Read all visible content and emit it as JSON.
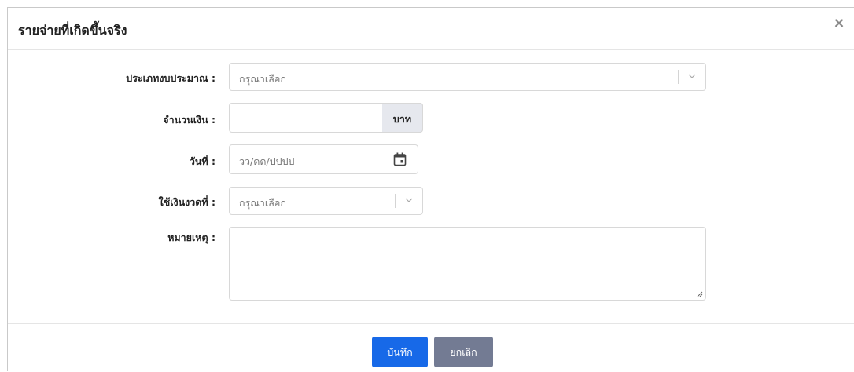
{
  "dialog": {
    "title": "รายจ่ายที่เกิดขึ้นจริง",
    "close_glyph": "×"
  },
  "form": {
    "budget_type": {
      "label": "ประเภทงบประมาณ :",
      "placeholder": "กรุณาเลือก"
    },
    "amount": {
      "label": "จำนวนเงิน :",
      "value": "",
      "unit": "บาท"
    },
    "date": {
      "label": "วันที่ :",
      "placeholder": "วว/ดด/ปปปป"
    },
    "installment": {
      "label": "ใช้เงินงวดที่ :",
      "placeholder": "กรุณาเลือก"
    },
    "note": {
      "label": "หมายเหตุ :",
      "value": ""
    }
  },
  "footer": {
    "save_label": "บันทึก",
    "cancel_label": "ยกเลิก"
  },
  "colors": {
    "primary": "#1769e8",
    "secondary": "#737b93",
    "addon_bg": "#e6e8ee"
  },
  "icons": {
    "close": "close-icon",
    "dropdown": "chevron-down-icon",
    "calendar": "calendar-icon",
    "resize": "resize-handle-icon"
  }
}
